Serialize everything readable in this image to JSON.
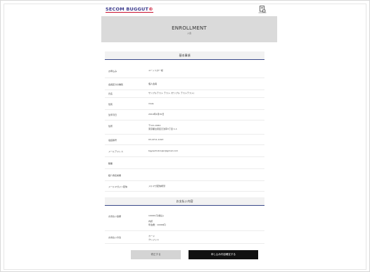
{
  "header": {
    "logo_text": "SECOM BUGGUT",
    "logo_mark": "®",
    "icon": "document-lock-icon"
  },
  "title": {
    "main": "ENROLLMENT",
    "sub": "入会"
  },
  "sections": [
    {
      "title": "基本事項",
      "rows": [
        {
          "label": "お申込み",
          "lines": [
            "ユーノスター様"
          ]
        },
        {
          "label": "会員区分の種別",
          "lines": [
            "個人会員"
          ]
        },
        {
          "label": "氏名",
          "lines": [
            "サンプルテスト テスト (サンプル テストテスト)"
          ]
        },
        {
          "label": "性別",
          "lines": [
            "male"
          ]
        },
        {
          "label": "生年月日",
          "lines": [
            "2019年4月30日"
          ]
        },
        {
          "label": "住所",
          "lines": [
            "〒111-0041",
            "東京都台東区元浅草3丁目 1-1"
          ]
        },
        {
          "label": "電話番号",
          "lines": [
            "03-4711-1193"
          ]
        },
        {
          "label": "メールアドレス",
          "lines": [
            "bgyserhobrojan@gmail.com"
          ]
        },
        {
          "label": "職業",
          "lines": [
            ""
          ]
        },
        {
          "label": "紹介者名前欄",
          "lines": [
            ""
          ]
        },
        {
          "label": "メールマガジン配信",
          "lines": [
            "メルマガ配信希望"
          ]
        }
      ]
    },
    {
      "title": "お支払い内容",
      "rows": [
        {
          "label": "お支払い金額",
          "lines": [
            "10000 円(税込)",
            "内訳",
            "年会費：10000円"
          ]
        },
        {
          "label": "お支払い方法",
          "lines": [
            "カード",
            "クレジット"
          ]
        }
      ]
    }
  ],
  "buttons": {
    "back": "修正する",
    "confirm": "申し込み内容確定する"
  }
}
